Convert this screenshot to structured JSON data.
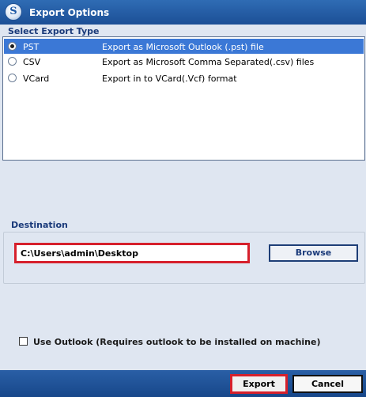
{
  "window": {
    "title": "Export Options",
    "icon_letter": "S"
  },
  "export_type": {
    "label": "Select Export Type",
    "options": [
      {
        "name": "PST",
        "description": "Export as Microsoft Outlook (.pst) file",
        "selected": true
      },
      {
        "name": "CSV",
        "description": "Export as Microsoft Comma Separated(.csv) files",
        "selected": false
      },
      {
        "name": "VCard",
        "description": "Export in to VCard(.Vcf) format",
        "selected": false
      }
    ]
  },
  "destination": {
    "label": "Destination",
    "path": "C:\\Users\\admin\\Desktop",
    "browse_label": "Browse"
  },
  "use_outlook": {
    "label": "Use Outlook (Requires outlook to be installed on machine)",
    "checked": false
  },
  "actions": {
    "export_label": "Export",
    "cancel_label": "Cancel"
  },
  "colors": {
    "titlebar": "#1c4f96",
    "selection": "#3b78d6",
    "highlight": "#d6202c"
  }
}
